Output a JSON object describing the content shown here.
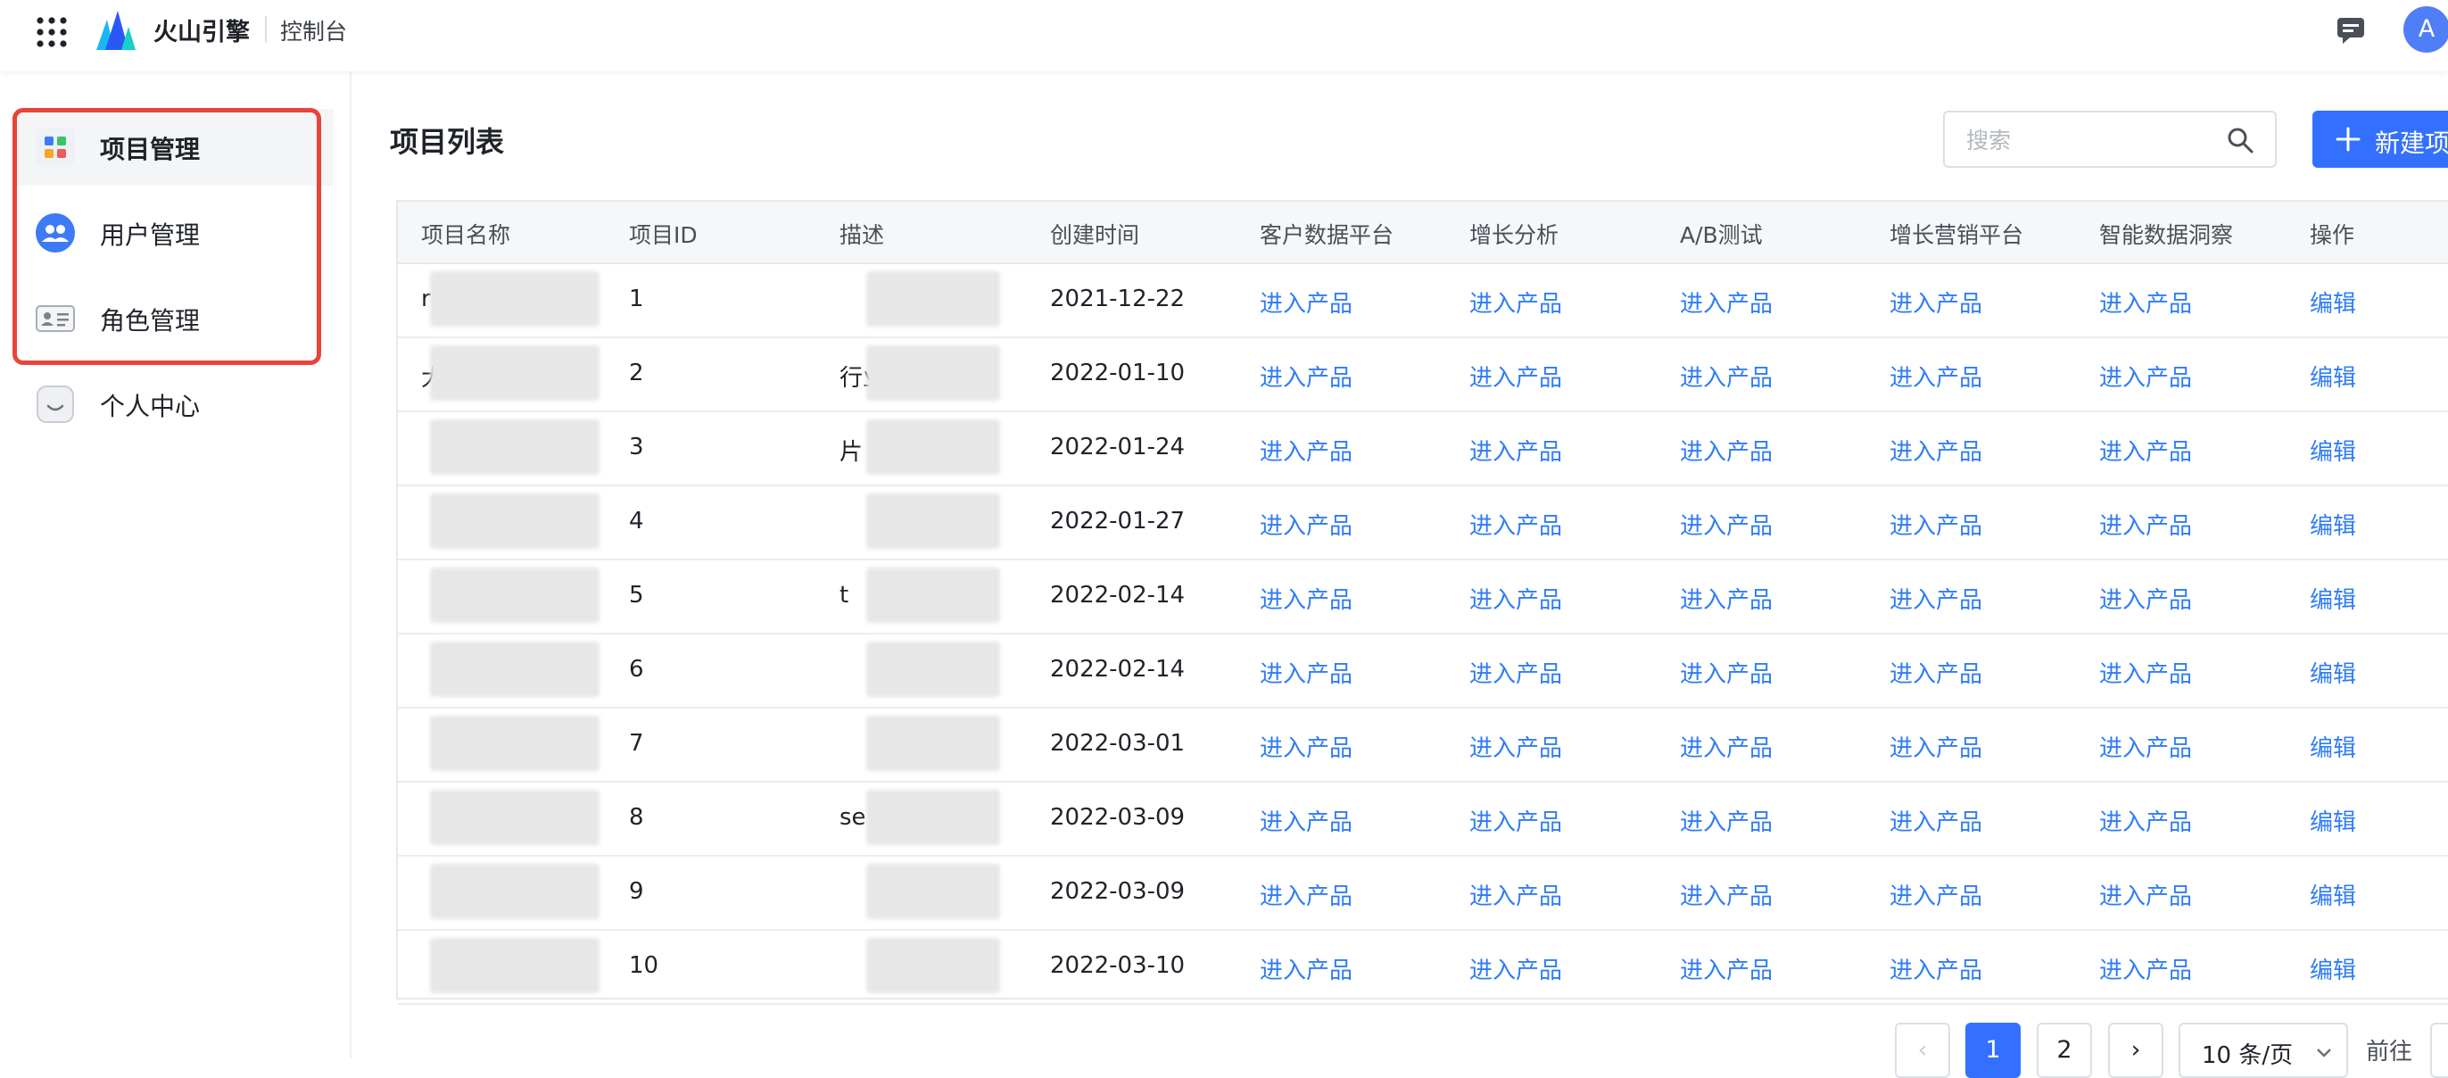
{
  "topbar": {
    "brand": "火山引擎",
    "console": "控制台",
    "avatar_letter": "A"
  },
  "sidebar": {
    "items": [
      {
        "label": "项目管理",
        "icon": "project-grid-icon",
        "active": true
      },
      {
        "label": "用户管理",
        "icon": "users-icon",
        "active": false
      },
      {
        "label": "角色管理",
        "icon": "id-card-icon",
        "active": false
      },
      {
        "label": "个人中心",
        "icon": "smile-icon",
        "active": false
      }
    ]
  },
  "main": {
    "title": "项目列表",
    "search_placeholder": "搜索",
    "new_button": "新建项"
  },
  "table": {
    "columns": [
      "项目名称",
      "项目ID",
      "描述",
      "创建时间",
      "客户数据平台",
      "增长分析",
      "A/B测试",
      "增长营销平台",
      "智能数据洞察",
      "操作"
    ],
    "link_text": "进入产品",
    "action_text": "编辑",
    "rows": [
      {
        "name": "r",
        "id": "1",
        "desc": "",
        "created": "2021-12-22"
      },
      {
        "name": "大",
        "id": "2",
        "desc": "行业de...",
        "created": "2022-01-10"
      },
      {
        "name": "",
        "id": "3",
        "desc": "片 行业...",
        "created": "2022-01-24"
      },
      {
        "name": "",
        "id": "4",
        "desc": "",
        "created": "2022-01-27"
      },
      {
        "name": "",
        "id": "5",
        "desc": "t",
        "created": "2022-02-14"
      },
      {
        "name": "",
        "id": "6",
        "desc": "",
        "created": "2022-02-14"
      },
      {
        "name": "",
        "id": "7",
        "desc": "",
        "created": "2022-03-01"
      },
      {
        "name": "",
        "id": "8",
        "desc": "se",
        "created": "2022-03-09"
      },
      {
        "name": "",
        "id": "9",
        "desc": "",
        "created": "2022-03-09"
      },
      {
        "name": "",
        "id": "10",
        "desc": "",
        "created": "2022-03-10"
      }
    ]
  },
  "pagination": {
    "prev": "‹",
    "pages": [
      "1",
      "2"
    ],
    "current": "1",
    "next": "›",
    "page_size": "10 条/页",
    "goto_label": "前往"
  },
  "colors": {
    "primary": "#3370ff",
    "link": "#2f7cf6",
    "highlight_outline": "#e8443a"
  }
}
